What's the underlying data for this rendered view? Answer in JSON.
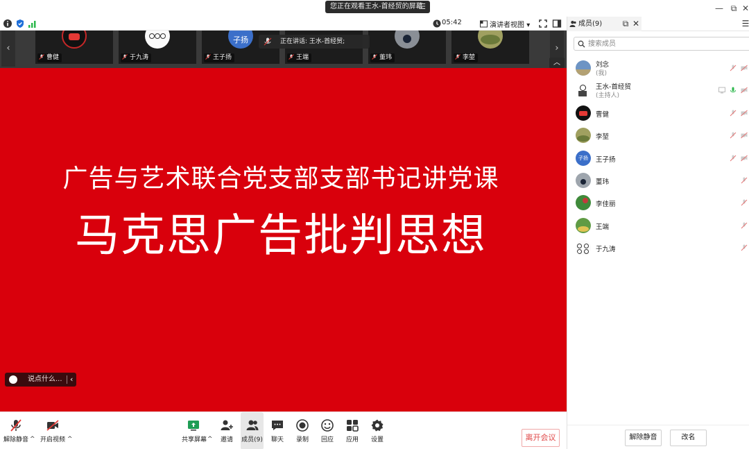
{
  "titlebar": {
    "share_notice": "您正在观看王水-首经贸的屏幕",
    "minimize": "—",
    "restore": "⧉",
    "close": "✕"
  },
  "meeting_toolbar": {
    "timer": "05:42",
    "view_mode": "演讲者视图",
    "view_caret": "▾"
  },
  "video_strip": {
    "prev_arrow": "‹",
    "next_arrow": "›",
    "collapse_arrow": "︿",
    "speaking_label": "正在讲话:  王水-首经贸;",
    "tiles": [
      {
        "name": "曹健"
      },
      {
        "name": "于九涛"
      },
      {
        "name": "王子扬",
        "avatar_text": "子扬"
      },
      {
        "name": "王端"
      },
      {
        "name": "董玮"
      },
      {
        "name": "李堃"
      }
    ]
  },
  "slide": {
    "subtitle": "广告与艺术联合党支部支部书记讲党课",
    "title": "马克思广告批判思想",
    "chat_placeholder": "说点什么...",
    "chat_collapse": "‹"
  },
  "bottom_toolbar": {
    "unmute": "解除静音",
    "start_video": "开启视频",
    "share_screen": "共享屏幕",
    "invite": "邀请",
    "members": "成员(9)",
    "chat": "聊天",
    "record": "录制",
    "replay": "回应",
    "apps": "应用",
    "settings": "设置",
    "leave": "离开会议",
    "caret": "^"
  },
  "panel": {
    "tab_label": "成员(9)",
    "search_placeholder": "搜索成员",
    "members": [
      {
        "name": "刘念",
        "role": "(我)"
      },
      {
        "name": "王水-首经贸",
        "role": "(主持人)"
      },
      {
        "name": "曹健",
        "role": ""
      },
      {
        "name": "李堃",
        "role": ""
      },
      {
        "name": "王子扬",
        "role": "",
        "avatar_text": "子扬"
      },
      {
        "name": "董玮",
        "role": ""
      },
      {
        "name": "李佳丽",
        "role": ""
      },
      {
        "name": "王端",
        "role": ""
      },
      {
        "name": "于九涛",
        "role": ""
      }
    ],
    "mute_all": "解除静音",
    "rename": "改名"
  },
  "colors": {
    "slide_red": "#d9000c",
    "accent_blue": "#1e6fd9",
    "leave_red": "#e04848"
  }
}
